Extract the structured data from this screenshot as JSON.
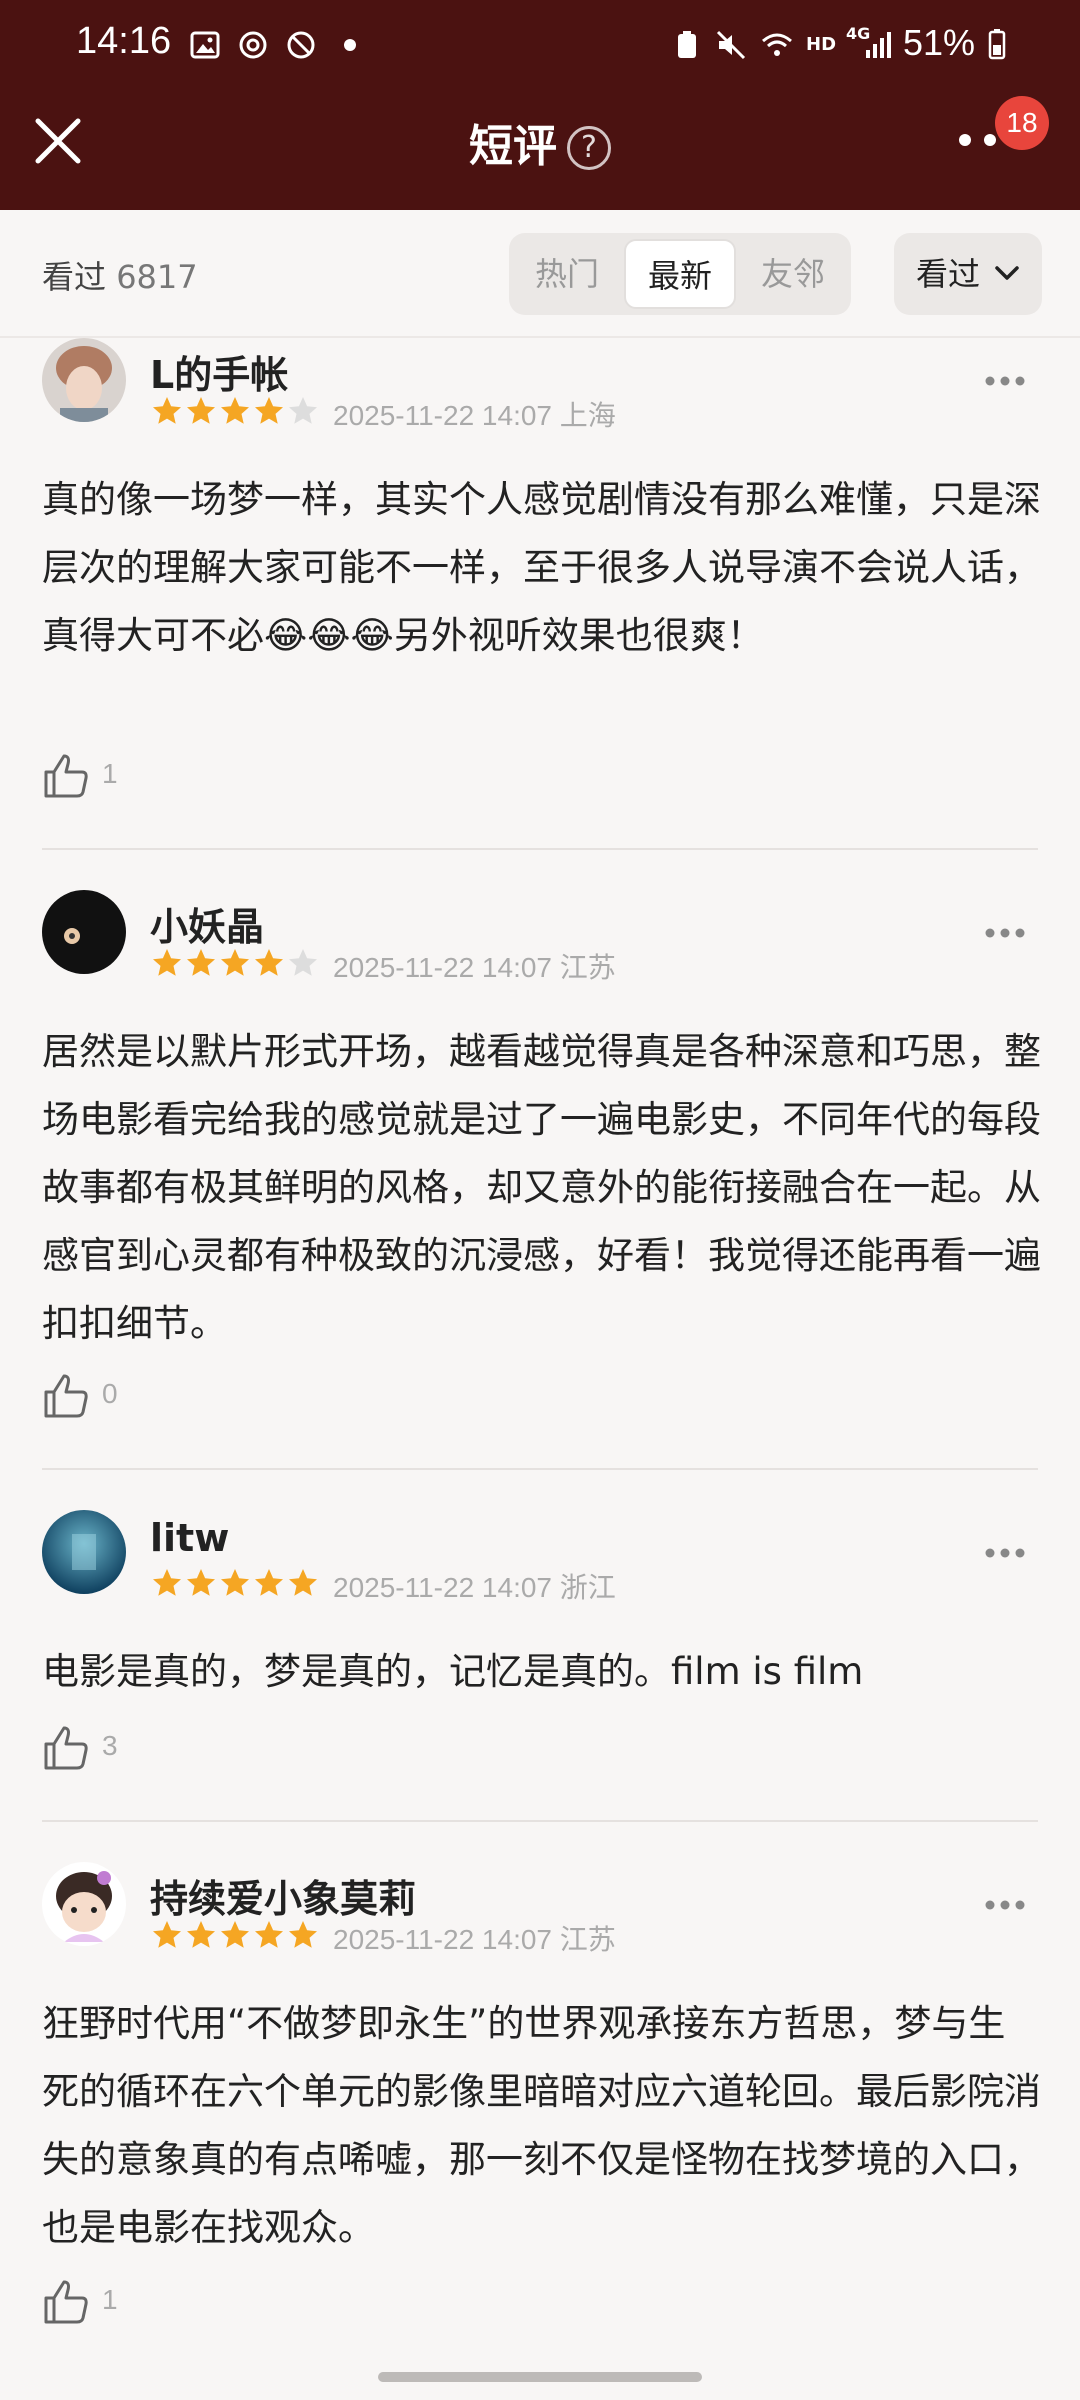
{
  "status_bar": {
    "time": "14:16",
    "battery": "51%",
    "network": "4G",
    "hd": "HD"
  },
  "header": {
    "title": "短评",
    "help": "?",
    "notification_count": "18"
  },
  "filter": {
    "seen_label": "看过",
    "seen_count": "6817",
    "tabs": [
      "热门",
      "最新",
      "友邻"
    ],
    "active_tab": "最新",
    "dropdown_label": "看过"
  },
  "colors": {
    "header_bg": "#4b1211",
    "star_on": "#f5a623",
    "star_off": "#dddddd",
    "badge": "#e8453c"
  },
  "reviews": [
    {
      "username": "L的手帐",
      "rating": 4,
      "date": "2025-11-22 14:07",
      "location": "上海",
      "content": "真的像一场梦一样，其实个人感觉剧情没有那么难懂，只是深层次的理解大家可能不一样，至于很多人说导演不会说人话，真得大可不必😂😂😂另外视听效果也很爽！",
      "likes": "1"
    },
    {
      "username": "小妖晶",
      "rating": 4,
      "date": "2025-11-22 14:07",
      "location": "江苏",
      "content": "居然是以默片形式开场，越看越觉得真是各种深意和巧思，整场电影看完给我的感觉就是过了一遍电影史，不同年代的每段故事都有极其鲜明的风格，却又意外的能衔接融合在一起。从感官到心灵都有种极致的沉浸感，好看！我觉得还能再看一遍扣扣细节。",
      "likes": "0"
    },
    {
      "username": "litw",
      "rating": 5,
      "date": "2025-11-22 14:07",
      "location": "浙江",
      "content": "电影是真的，梦是真的，记忆是真的。film is film",
      "likes": "3"
    },
    {
      "username": "持续爱小象莫莉",
      "rating": 5,
      "date": "2025-11-22 14:07",
      "location": "江苏",
      "content": "狂野时代用“不做梦即永生”的世界观承接东方哲思，梦与生死的循环在六个单元的影像里暗暗对应六道轮回。最后影院消失的意象真的有点唏嘘，那一刻不仅是怪物在找梦境的入口，也是电影在找观众。",
      "likes": "1"
    }
  ]
}
